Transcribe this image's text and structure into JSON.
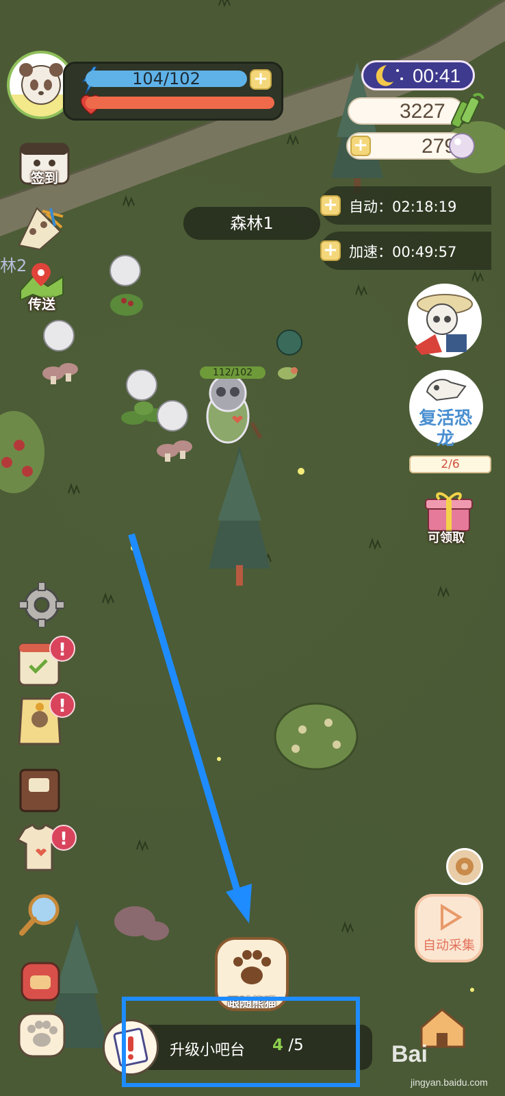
{
  "player": {
    "energy_text": "104/102",
    "energy_fraction": 1.0,
    "health_fraction": 1.0
  },
  "left_menu": {
    "checkin_label": "签到",
    "area_fragment": "林2",
    "teleport_label": "传送"
  },
  "right_panel": {
    "timer": "00:41",
    "bamboo_count": "3227",
    "pearl_count": "279",
    "auto_label": "自动：02:18:19",
    "speed_label": "加速：00:49:57",
    "revive_dino_label_line1": "复活恐",
    "revive_dino_label_line2": "龙",
    "revive_dino_progress": "2/6",
    "gift_label": "可领取",
    "auto_collect_label": "自动采集"
  },
  "map": {
    "area_name": "森林1",
    "character_hp": "112/102"
  },
  "bottom": {
    "follow_label": "跟随熊猫",
    "upgrade_label": "升级小吧台",
    "upgrade_current": "4",
    "upgrade_total": "/5"
  },
  "badges": {
    "mark": "!"
  },
  "watermark": {
    "brand": "Bai",
    "sub": "jingyan.baidu.com"
  },
  "colors": {
    "grass": "#4b5a35",
    "highlight_blue": "#1e8cff",
    "energy_blue": "#5fb2e8",
    "health_red": "#ef6a4a",
    "badge_red": "#d9435c"
  }
}
